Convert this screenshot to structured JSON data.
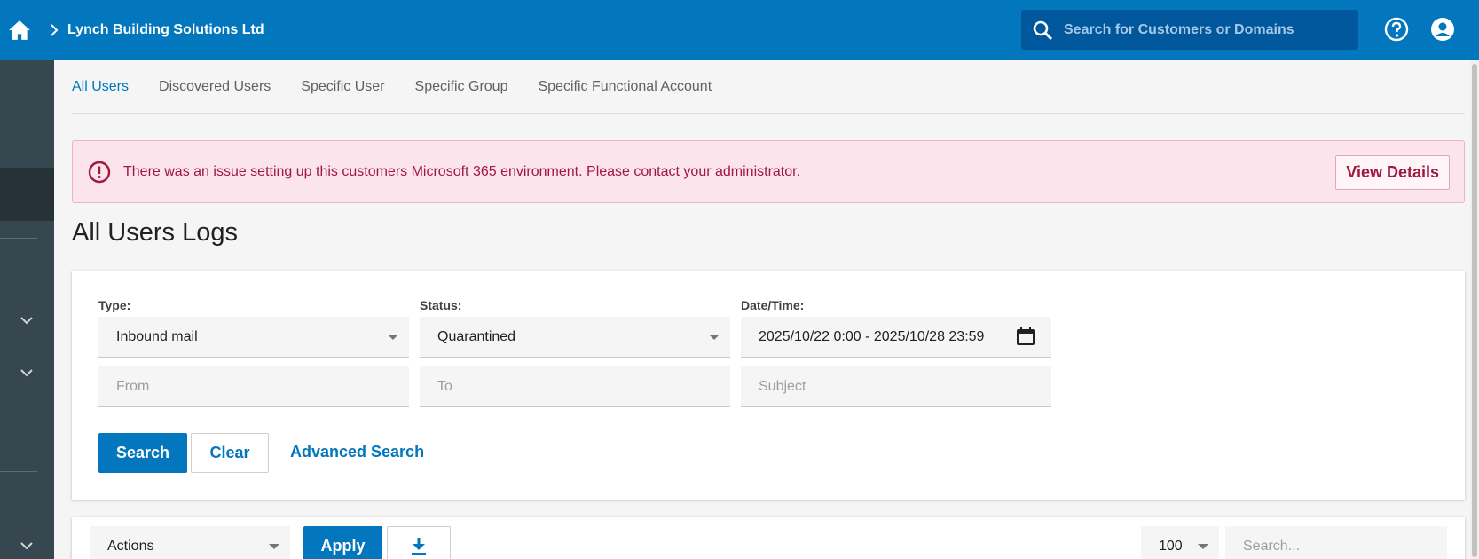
{
  "header": {
    "breadcrumb": "Lynch Building Solutions Ltd",
    "search_placeholder": "Search for Customers or Domains",
    "icons": [
      "home-icon",
      "chevron-right-icon",
      "search-icon",
      "help-icon",
      "account-icon"
    ]
  },
  "tabs": [
    {
      "label": "All Users",
      "active": true
    },
    {
      "label": "Discovered Users",
      "active": false
    },
    {
      "label": "Specific User",
      "active": false
    },
    {
      "label": "Specific Group",
      "active": false
    },
    {
      "label": "Specific Functional Account",
      "active": false
    }
  ],
  "alert": {
    "message": "There was an issue setting up this customers Microsoft 365 environment. Please contact your administrator.",
    "button": "View Details"
  },
  "page": {
    "title": "All Users Logs"
  },
  "filters": {
    "type_label": "Type:",
    "type_value": "Inbound mail",
    "status_label": "Status:",
    "status_value": "Quarantined",
    "datetime_label": "Date/Time:",
    "datetime_value": "2025/10/22 0:00 - 2025/10/28 23:59",
    "from_placeholder": "From",
    "to_placeholder": "To",
    "subject_placeholder": "Subject",
    "search_button": "Search",
    "clear_button": "Clear",
    "advanced_search": "Advanced Search"
  },
  "table_toolbar": {
    "actions_value": "Actions",
    "apply_button": "Apply",
    "page_size": "100",
    "search_placeholder": "Search..."
  },
  "colors": {
    "primary": "#0277bd",
    "sidebar": "#37474f",
    "alert_bg": "#fce4ec",
    "alert_text": "#a0183f"
  }
}
